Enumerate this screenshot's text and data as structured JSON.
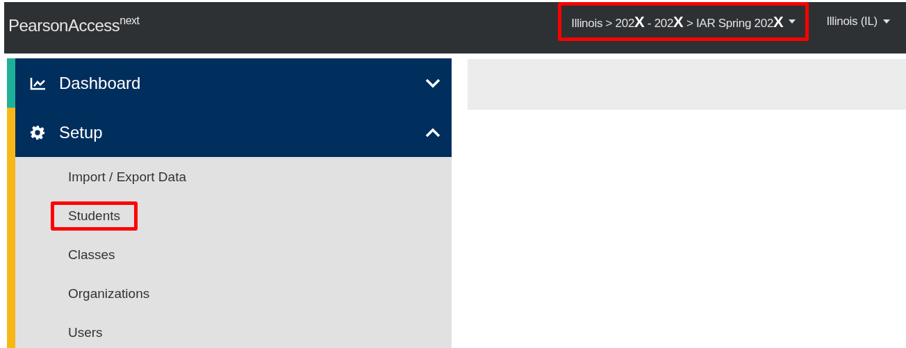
{
  "header": {
    "logo": "PearsonAccess$^{next}$",
    "context_menu": {
      "text": "Illinois > 202**X** - 202**X** > IAR Spring 202**X**",
      "highlighted": true
    },
    "org_menu": {
      "text": "Illinois (IL)",
      "highlighted": false
    }
  },
  "sidebar": {
    "sections": [
      {
        "label": "Dashboard",
        "color": "#1fb09a",
        "expanded": false
      },
      {
        "label": "Setup",
        "color": "#f7b718",
        "expanded": true,
        "items": [
          {
            "label": "Import / Export Data",
            "highlighted": false
          },
          {
            "label": "Students",
            "highlighted": true
          },
          {
            "label": "Classes",
            "highlighted": false
          },
          {
            "label": "Organizations",
            "highlighted": false
          },
          {
            "label": "Users",
            "highlighted": false
          }
        ]
      }
    ]
  }
}
